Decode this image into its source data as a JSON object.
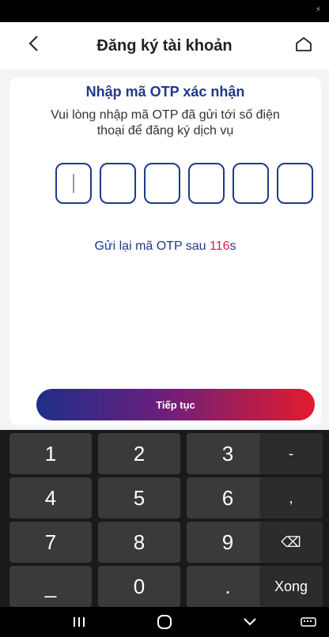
{
  "header": {
    "title": "Đăng ký tài khoản"
  },
  "otp": {
    "title": "Nhập mã OTP xác nhận",
    "description": "Vui lòng nhập mã OTP đã gửi tới số điện thoại để đăng ký dịch vụ",
    "boxes": [
      "",
      "",
      "",
      "",
      "",
      ""
    ],
    "resend_prefix": "Gửi lại mã OTP sau ",
    "countdown": "116",
    "resend_suffix": "s"
  },
  "actions": {
    "continue_label": "Tiếp tục"
  },
  "keyboard": {
    "keys": [
      [
        "1",
        "2",
        "3",
        "-"
      ],
      [
        "4",
        "5",
        "6",
        ","
      ],
      [
        "7",
        "8",
        "9",
        "⌫"
      ],
      [
        "_",
        "0",
        ".",
        "Xong"
      ]
    ]
  },
  "icons": {
    "back": "chevron-left-icon",
    "home": "home-icon",
    "recent_apps": "recent-apps-icon",
    "home_nav": "home-nav-icon",
    "back_nav": "back-nav-icon",
    "keyboard": "keyboard-icon"
  },
  "colors": {
    "accent": "#1e3a8a",
    "countdown": "#e11d48",
    "gradient_start": "#1e2f8a",
    "gradient_end": "#e31b2d"
  }
}
